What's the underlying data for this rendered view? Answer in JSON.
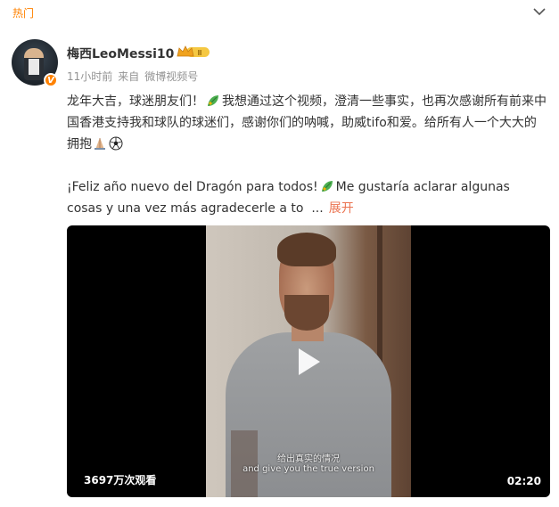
{
  "header": {
    "hot_tag": "热门",
    "menu_icon": "chevron-down-icon"
  },
  "post": {
    "username": "梅西LeoMessi10",
    "vip_badge": "II",
    "verified_badge": "V",
    "time": "11小时前",
    "source_prefix": "来自",
    "source": "微博视频号",
    "text_zh_1": "龙年大吉，球迷朋友们！",
    "text_zh_2": "我想通过这个视频，澄清一些事实，也再次感谢所有前来中国香港支持我和球队的球迷们，感谢你们的呐喊，助威tifo和爱。给所有人一个大大的拥抱",
    "text_es_1": "¡Feliz año nuevo del Dragón para todos!",
    "text_es_2": "Me gustaría aclarar algunas cosas y una vez más agradecerle a to",
    "ellipsis": "...",
    "expand_label": "展开"
  },
  "video": {
    "subtitle_zh": "给出真实的情况",
    "subtitle_en": "and give you the true version",
    "views": "3697万次观看",
    "duration": "02:20"
  },
  "colors": {
    "accent": "#ff8200",
    "link": "#eb7350",
    "meta": "#939393"
  }
}
